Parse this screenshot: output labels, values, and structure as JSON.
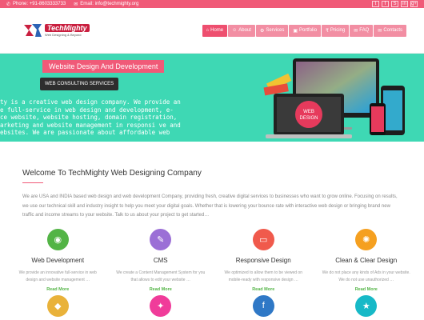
{
  "topbar": {
    "phone": "Phone: +91-8603333733",
    "email": "Email: info@techmighty.org",
    "socials": [
      "t",
      "f",
      "S",
      "in",
      "g+"
    ]
  },
  "logo": {
    "name": "TechMighty",
    "tagline": "Web Designing & Beyond"
  },
  "nav": [
    {
      "label": "Home",
      "icon": "home-icon"
    },
    {
      "label": "About",
      "icon": "user-icon"
    },
    {
      "label": "Services",
      "icon": "gear-icon"
    },
    {
      "label": "Portfolio",
      "icon": "camera-icon"
    },
    {
      "label": "Pricing",
      "icon": "rupee-icon"
    },
    {
      "label": "FAQ",
      "icon": "comments-icon"
    },
    {
      "label": "Contacts",
      "icon": "envelope-icon"
    }
  ],
  "hero": {
    "title": "Website Design And Development",
    "button": "WEB CONSULTING SERVICES",
    "lines": [
      "ty is a creative web design company. We provide an",
      "e full-service in web design and development, e-",
      "ce website, website hosting, domain registration,",
      "arketing and website management in responsi ve and",
      "ebsites. We are passionate about affordable web"
    ],
    "screen_label": "WEB DESIGN"
  },
  "welcome": {
    "title": "Welcome To TechMighty Web Designing Company",
    "paragraph": "We are USA and INDIA based web design and web development Company, providing fresh, creative digital services to businesses who want to grow online. Focusing on results, we use our technical skill and industry insight to help you meet your digital goals. Whether that is lowering your bounce rate with interactive web design or bringing brand new traffic and income streams to your website. Talk to us about your project to get started…"
  },
  "services": [
    {
      "title": "Web Development",
      "desc": "We provide an innovative full-service in web design and website management …",
      "more": "Read More",
      "color": "#53b446",
      "icon": "globe-icon",
      "glyph": "◉"
    },
    {
      "title": "CMS",
      "desc": "We create a Content Management System for you that allows to edit your website …",
      "more": "Read More",
      "color": "#9b6fd6",
      "icon": "edit-icon",
      "glyph": "✎"
    },
    {
      "title": "Responsive Design",
      "desc": "We optimized to allow them to be viewed on mobile-ready with responsive design …",
      "more": "Read More",
      "color": "#f05a4c",
      "icon": "monitor-icon",
      "glyph": "▭"
    },
    {
      "title": "Clean & Clear Design",
      "desc": "We do not place any kinds of Ads in your website. We do not use unauthorized …",
      "more": "Read More",
      "color": "#f5a020",
      "icon": "lightbulb-icon",
      "glyph": "✺"
    }
  ],
  "services_row2": [
    {
      "color": "#e9b23a",
      "icon": "cart-icon",
      "glyph": "◆"
    },
    {
      "color": "#f03c9a",
      "icon": "share-icon",
      "glyph": "✦"
    },
    {
      "color": "#2f78c6",
      "icon": "facebook-icon",
      "glyph": "f"
    },
    {
      "color": "#17b9c7",
      "icon": "star-icon",
      "glyph": "★"
    }
  ]
}
